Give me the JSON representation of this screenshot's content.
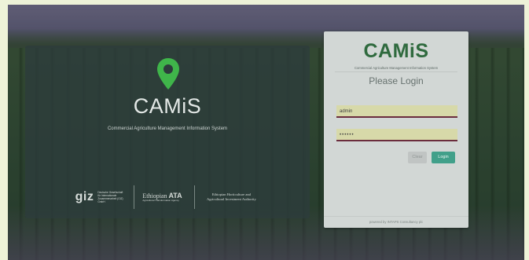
{
  "left": {
    "app_name": "CAMiS",
    "tagline": "Commercial Agriculture Management Information System",
    "partners": {
      "giz_word": "giz",
      "giz_text": "Deutsche Gesellschaft für Internationale Zusammenarbeit (GIZ) GmbH",
      "ata_word": "Ethiopian",
      "ata_logo": "ATA",
      "ata_text": "Agricultural Transformation Agency",
      "ehia_text": "Ethiopian Horticulture and Agricultural Investment Authority"
    }
  },
  "login": {
    "logo": "CAMiS",
    "logo_sub": "Commercial Agriculture Management Information System",
    "heading": "Please Login",
    "username_value": "admin",
    "password_value": "••••••",
    "clear_label": "Clear",
    "login_label": "Login",
    "footer": "powered by INTAPS Consultancy plc"
  },
  "colors": {
    "pin": "#3fb54a",
    "login_button": "#41a08a",
    "logo_green": "#2f6a3e"
  }
}
